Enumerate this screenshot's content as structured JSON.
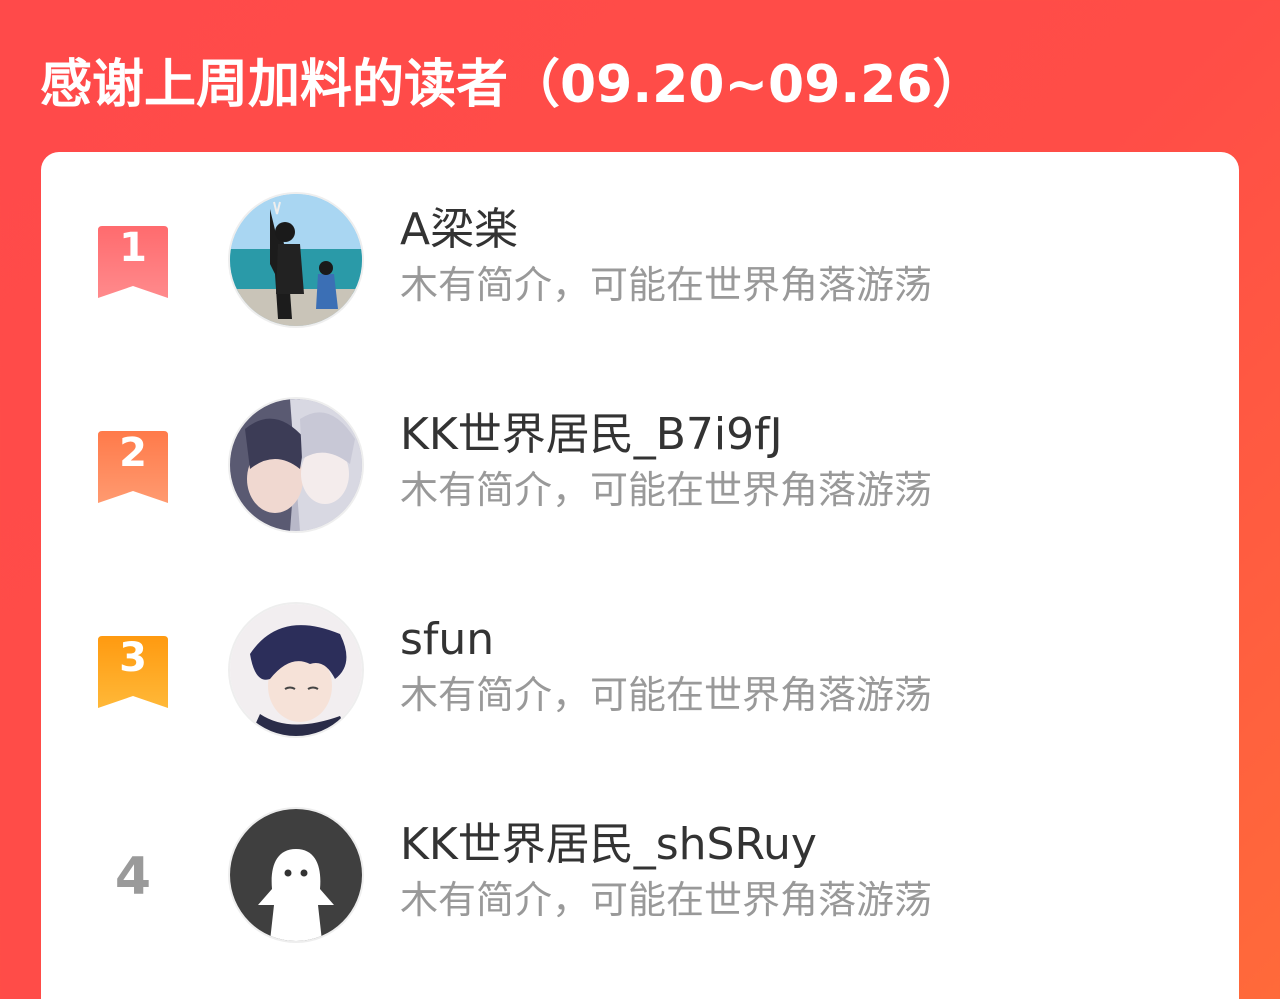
{
  "header": {
    "title": "感谢上周加料的读者（09.20~09.26）"
  },
  "colors": {
    "background_start": "#ff4a4a",
    "background_end": "#ff6a3a",
    "rank1": "#ff5a5f",
    "rank2": "#ff7a45",
    "rank3": "#ffa020",
    "rank_plain": "#9a9a9a"
  },
  "readers": [
    {
      "rank": "1",
      "name": "A梁楽",
      "bio": "木有简介，可能在世界角落游荡",
      "avatar_icon": "beach-photo-avatar"
    },
    {
      "rank": "2",
      "name": "KK世界居民_B7i9fJ",
      "bio": "木有简介，可能在世界角落游荡",
      "avatar_icon": "anime-couple-avatar"
    },
    {
      "rank": "3",
      "name": "sfun",
      "bio": "木有简介，可能在世界角落游荡",
      "avatar_icon": "anime-boy-avatar"
    },
    {
      "rank": "4",
      "name": "KK世界居民_shSRuy",
      "bio": "木有简介，可能在世界角落游荡",
      "avatar_icon": "default-ghost-avatar"
    }
  ]
}
